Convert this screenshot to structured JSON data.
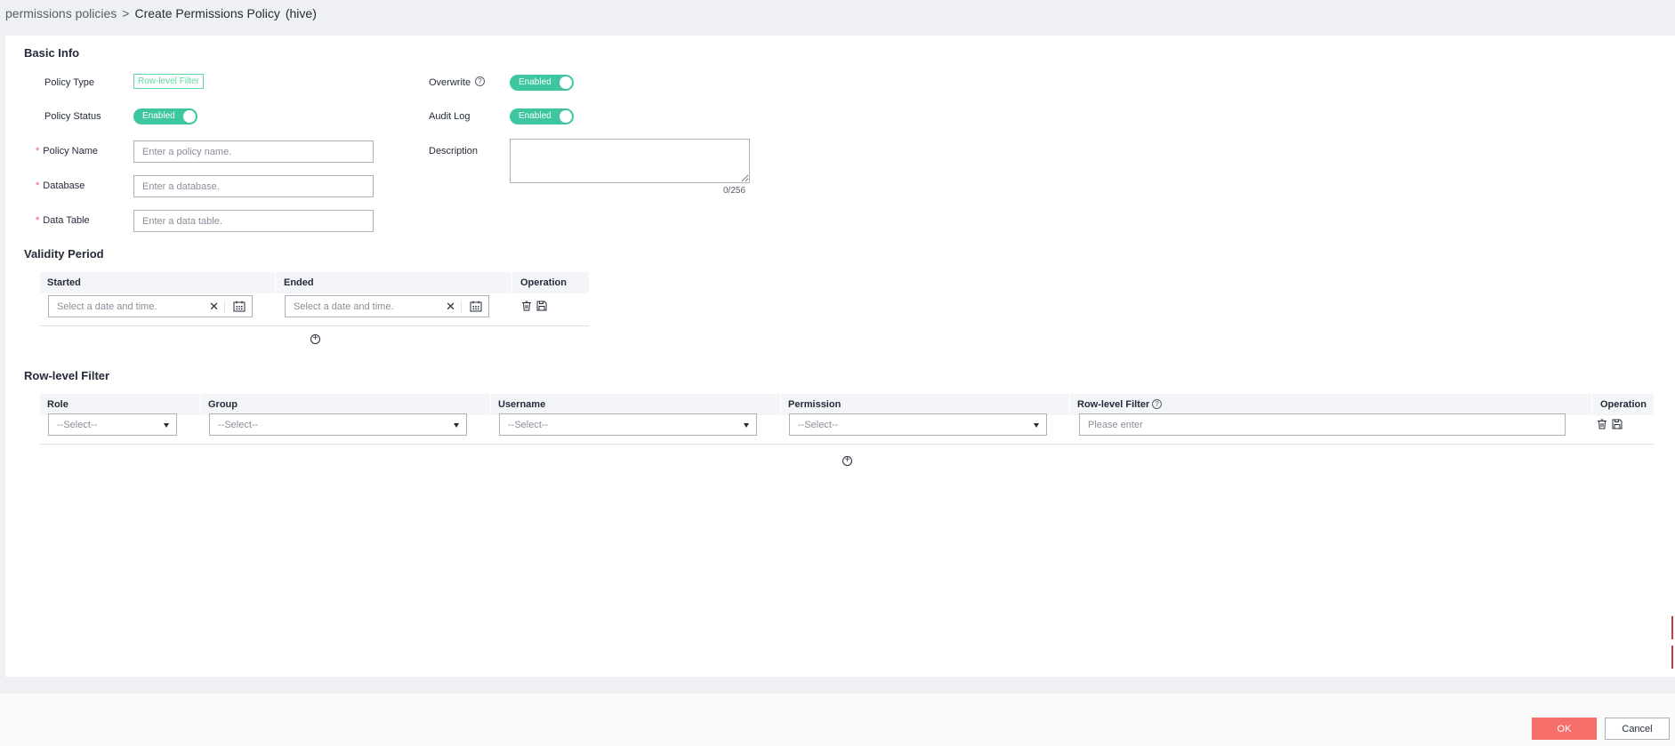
{
  "breadcrumb": {
    "parent": "permissions policies",
    "separator": ">",
    "current": "Create Permissions Policy",
    "suffix": "(hive)"
  },
  "basic_info": {
    "title": "Basic Info",
    "policy_type_label": "Policy Type",
    "policy_type_value": "Row-level Filter",
    "policy_status_label": "Policy Status",
    "policy_status_value": "Enabled",
    "policy_name_label": "Policy Name",
    "policy_name_placeholder": "Enter a policy name.",
    "database_label": "Database",
    "database_placeholder": "Enter a database.",
    "data_table_label": "Data Table",
    "data_table_placeholder": "Enter a data table.",
    "overwrite_label": "Overwrite",
    "overwrite_value": "Enabled",
    "audit_log_label": "Audit Log",
    "audit_log_value": "Enabled",
    "description_label": "Description",
    "description_counter": "0/256",
    "required_mark": "*"
  },
  "validity": {
    "title": "Validity Period",
    "columns": [
      "Started",
      "Ended",
      "Operation"
    ],
    "date_placeholder": "Select a date and time.",
    "clear_glyph": "✕"
  },
  "row_filter": {
    "title": "Row-level Filter",
    "columns": [
      "Role",
      "Group",
      "Username",
      "Permission",
      "Row-level Filter",
      "Operation"
    ],
    "select_placeholder": "--Select--",
    "filter_placeholder": "Please enter"
  },
  "icons": {
    "help": "?",
    "add": "+"
  },
  "footer": {
    "ok_label": "OK",
    "cancel_label": "Cancel"
  },
  "colors": {
    "accent_green": "#3ec6a1",
    "ok_button": "#f66f6a",
    "required": "#f5565d"
  }
}
